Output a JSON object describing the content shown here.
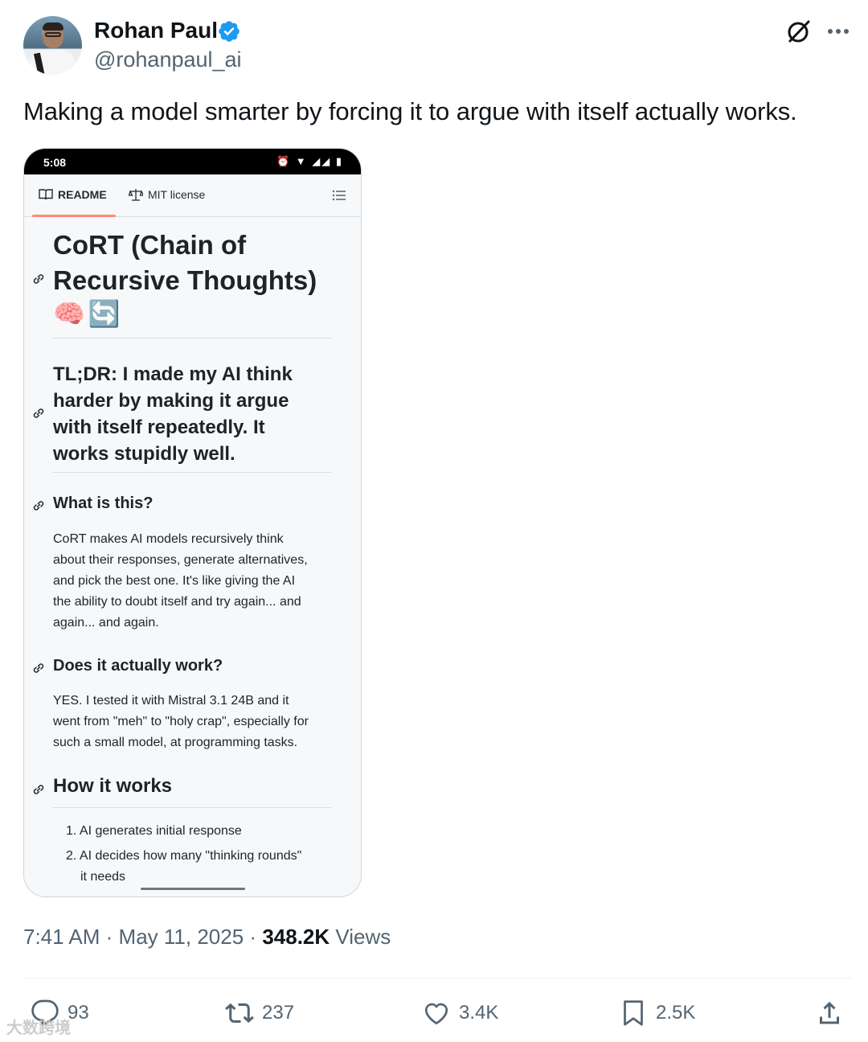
{
  "author": {
    "name": "Rohan Paul",
    "handle": "@rohanpaul_ai",
    "verified": true,
    "verified_color": "#1d9bf0"
  },
  "header_icons": [
    "grok-icon",
    "more-icon"
  ],
  "tweet": {
    "text": "Making a model smarter by forcing it to argue with itself actually works."
  },
  "screenshot": {
    "status_time": "5:08",
    "tabs": [
      {
        "label": "README",
        "icon": "book-icon",
        "active": true
      },
      {
        "label": "MIT license",
        "icon": "scale-icon",
        "active": false
      }
    ],
    "title_line1": "CoRT (Chain of",
    "title_line2": "Recursive Thoughts)",
    "title_emoji": "🧠🔄",
    "tldr_lines": [
      "TL;DR: I made my AI think",
      "harder by making it argue",
      "with itself repeatedly. It",
      "works stupidly well."
    ],
    "section1": {
      "heading": "What is this?",
      "lines": [
        "CoRT makes AI models recursively think",
        "about their responses, generate alternatives,",
        "and pick the best one. It's like giving the AI",
        "the ability to doubt itself and try again... and",
        "again... and again."
      ]
    },
    "section2": {
      "heading": "Does it actually work?",
      "lines": [
        "YES. I tested it with Mistral 3.1 24B and it",
        "went from \"meh\" to \"holy crap\", especially for",
        "such a small model, at programming tasks."
      ]
    },
    "section3": {
      "heading": "How it works",
      "items": [
        "1. AI generates initial response",
        "2. AI decides how many \"thinking rounds\"",
        "it needs"
      ]
    }
  },
  "meta": {
    "time": "7:41 AM",
    "sep1": "·",
    "date": "May 11, 2025",
    "sep2": "·",
    "views_count": "348.2K",
    "views_label": "Views"
  },
  "actions": {
    "replies": "93",
    "retweets": "237",
    "likes": "3.4K",
    "bookmarks": "2.5K"
  },
  "watermark": "大数跨境"
}
